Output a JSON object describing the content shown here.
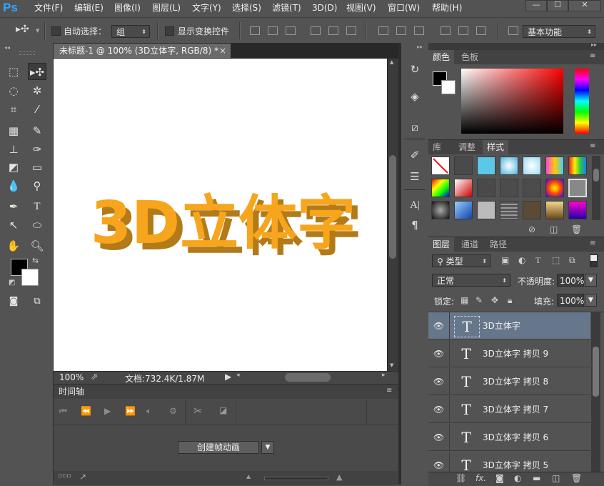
{
  "app": {
    "logo": "Ps",
    "workspace": "基本功能"
  },
  "menu": [
    "文件(F)",
    "编辑(E)",
    "图像(I)",
    "图层(L)",
    "文字(Y)",
    "选择(S)",
    "滤镜(T)",
    "3D(D)",
    "视图(V)",
    "窗口(W)",
    "帮助(H)"
  ],
  "window_controls": {
    "minimize": "—",
    "restore": "☐",
    "close": "✕"
  },
  "options": {
    "auto_select_label": "自动选择：",
    "auto_select_value": "组",
    "transform_controls_label": "显示变换控件"
  },
  "document": {
    "tab_title": "未标题-1 @ 100% (3D立体字, RGB/8) *",
    "tab_close": "×",
    "canvas_text": "3D立体字",
    "text_color": "#f7a51c",
    "shadow_color": "#b27a18",
    "zoom": "100%",
    "doc_info": "文档:732.4K/1.87M"
  },
  "timeline": {
    "tab": "时间轴",
    "create_button": "创建帧动画"
  },
  "color_panel": {
    "tabs": [
      "颜色",
      "色板"
    ],
    "foreground": "#000000",
    "background": "#ffffff"
  },
  "styles_panel": {
    "tabs": [
      "库",
      "调整",
      "样式"
    ]
  },
  "layers_panel": {
    "tabs": [
      "图层",
      "通道",
      "路径"
    ],
    "filter_label": "类型",
    "blend_mode": "正常",
    "opacity_label": "不透明度:",
    "opacity_value": "100%",
    "lock_label": "锁定:",
    "fill_label": "填充:",
    "fill_value": "100%",
    "layers": [
      {
        "name": "3D立体字",
        "selected": true
      },
      {
        "name": "3D立体字 拷贝 9",
        "selected": false
      },
      {
        "name": "3D立体字 拷贝 8",
        "selected": false
      },
      {
        "name": "3D立体字 拷贝 7",
        "selected": false
      },
      {
        "name": "3D立体字 拷贝 6",
        "selected": false
      },
      {
        "name": "3D立体字 拷贝 5",
        "selected": false
      }
    ],
    "layer_type_glyph": "T",
    "footer_fx": "fx."
  }
}
